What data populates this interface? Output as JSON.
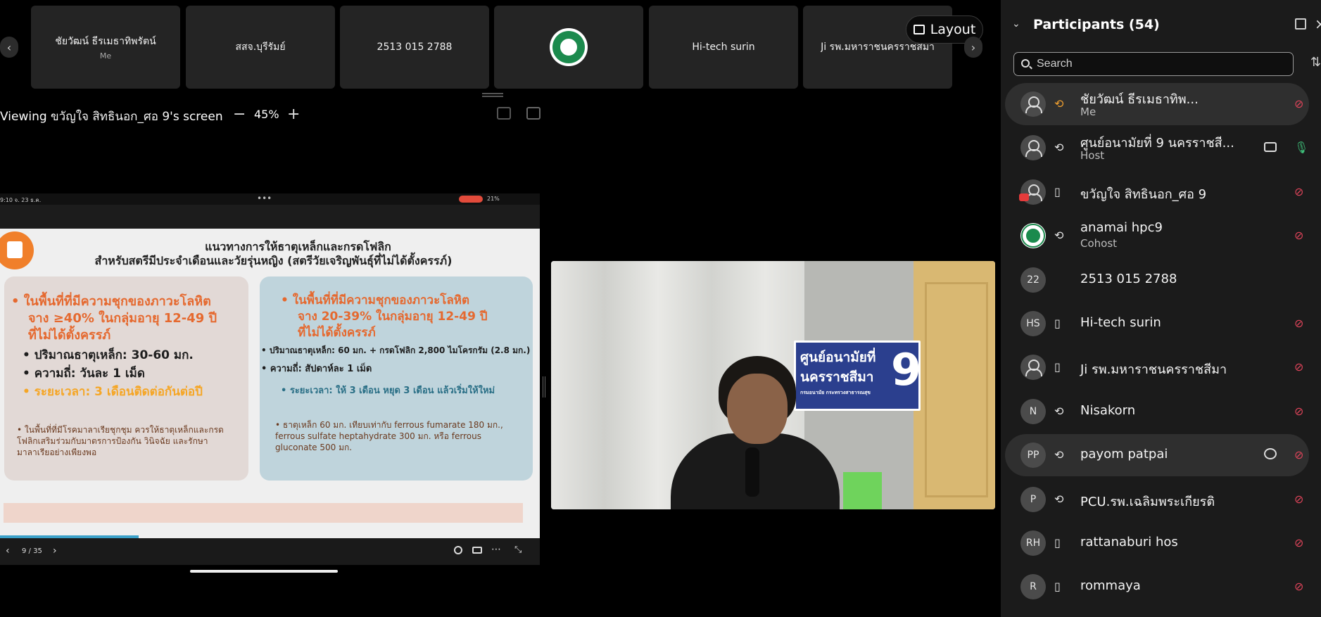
{
  "strip": {
    "tiles": [
      {
        "name": "ชัยวัฒน์ ธีรเมธาทิพรัตน์",
        "sub": "Me"
      },
      {
        "name": "สสจ.บุรีรัมย์"
      },
      {
        "name": "2513 015 2788"
      },
      {
        "name": "",
        "logo": "green-seal"
      },
      {
        "name": "Hi-tech surin"
      },
      {
        "name": "Ji รพ.มหาราชนครราชสีมา"
      }
    ],
    "layout_label": "Layout",
    "prev_icon": "‹",
    "next_icon": "›"
  },
  "viewing": {
    "prefix": "Viewing ",
    "who": "ขวัญใจ สิทธินอก_ศอ 9",
    "suffix": "'s screen",
    "zoom": "45%",
    "minus": "−",
    "plus": "+"
  },
  "shared_screen": {
    "status_time": "9:10   จ. 23 ธ.ค.",
    "status_dots": "•••",
    "status_right": "21%",
    "slide": {
      "title_1": "แนวทางการให้ธาตุเหล็กและกรดโฟลิก",
      "title_2": "สำหรับสตรีมีประจำเดือนและวัยรุ่นหญิง (สตรีวัยเจริญพันธุ์ที่ไม่ได้ตั้งครรภ์)",
      "left": {
        "h1": "• ในพื้นที่ที่มีความชุกของภาวะโลหิต",
        "h2": "จาง ≥40% ในกลุ่มอายุ 12-49 ปี",
        "h3": "ที่ไม่ได้ตั้งครรภ์",
        "b1": "• ปริมาณธาตุเหล็ก: 30-60 มก.",
        "b2": "• ความถี่: วันละ 1 เม็ด",
        "b3": "• ระยะเวลา: 3 เดือนติดต่อกันต่อปี",
        "note": "ในพื้นที่ที่มีโรคมาลาเรียชุกชุม ควรให้ธาตุเหล็กและกรดโฟลิกเสริมร่วมกับมาตรการป้องกัน วินิจฉัย และรักษามาลาเรียอย่างเพียงพอ"
      },
      "right": {
        "h1": "• ในพื้นที่ที่มีความชุกของภาวะโลหิต",
        "h2": "จาง 20-39% ในกลุ่มอายุ 12-49 ปี",
        "h3": "ที่ไม่ได้ตั้งครรภ์",
        "b1": "• ปริมาณธาตุเหล็ก: 60 มก. + กรดโฟลิก 2,800 ไมโครกรัม (2.8 มก.)",
        "b2": "• ความถี่: สัปดาห์ละ 1 เม็ด",
        "b3": "• ระยะเวลา: ให้ 3 เดือน หยุด 3 เดือน แล้วเริ่มให้ใหม่",
        "note": "ธาตุเหล็ก 60 มก. เทียบเท่ากับ ferrous fumarate 180 มก., ferrous sulfate heptahydrate 300 มก. หรือ ferrous gluconate 500 มก."
      },
      "progress": 0.257
    },
    "pager": "9 / 35",
    "pager_prev": "‹",
    "pager_next": "›"
  },
  "video": {
    "sign_line1": "ศูนย์อนามัยที่",
    "sign_line2": "นครราชสีมา",
    "sign_line3": "กรมอนามัย กระทรวงสาธารณสุข",
    "sign_num": "9"
  },
  "participants": {
    "title": "Participants (54)",
    "search_placeholder": "Search",
    "list": [
      {
        "name": "ชัยวัฒน์ ธีรเมธาทิพ...",
        "role": "Me",
        "avatar": "user-icon",
        "device": "headset-icon",
        "mic": "muted",
        "highlight": true
      },
      {
        "name": "ศูนย์อนามัยที่ 9 นครราชสี...",
        "role": "Host",
        "avatar": "user-icon",
        "device": "headset-icon",
        "mic": "on",
        "camera": true
      },
      {
        "name": "ขวัญใจ สิทธินอก_ศอ 9",
        "role": "",
        "avatar": "user-icon",
        "device": "phone-icon",
        "mic": "muted",
        "sharing": true
      },
      {
        "name": "anamai hpc9",
        "role": "Cohost",
        "avatar": "seal",
        "device": "headset-icon",
        "mic": "muted"
      },
      {
        "name": "2513 015 2788",
        "role": "",
        "avatar": "22",
        "device": "",
        "mic": "none"
      },
      {
        "name": "Hi-tech surin",
        "role": "",
        "avatar": "HS",
        "device": "phone-icon",
        "mic": "muted"
      },
      {
        "name": "Ji รพ.มหาราชนครราชสีมา",
        "role": "",
        "avatar": "user-icon",
        "device": "phone-icon",
        "mic": "muted"
      },
      {
        "name": "Nisakorn",
        "role": "",
        "avatar": "N",
        "device": "headset-icon",
        "mic": "muted"
      },
      {
        "name": "payom patpai",
        "role": "",
        "avatar": "PP",
        "device": "headset-icon",
        "mic": "muted",
        "chat": true,
        "highlight": true
      },
      {
        "name": "PCU.รพ.เฉลิมพระเกียรติ",
        "role": "",
        "avatar": "P",
        "device": "headset-icon",
        "mic": "muted"
      },
      {
        "name": "rattanaburi hos",
        "role": "",
        "avatar": "RH",
        "device": "phone-icon",
        "mic": "muted"
      },
      {
        "name": "rommaya",
        "role": "",
        "avatar": "R",
        "device": "phone-icon",
        "mic": "muted"
      }
    ]
  }
}
